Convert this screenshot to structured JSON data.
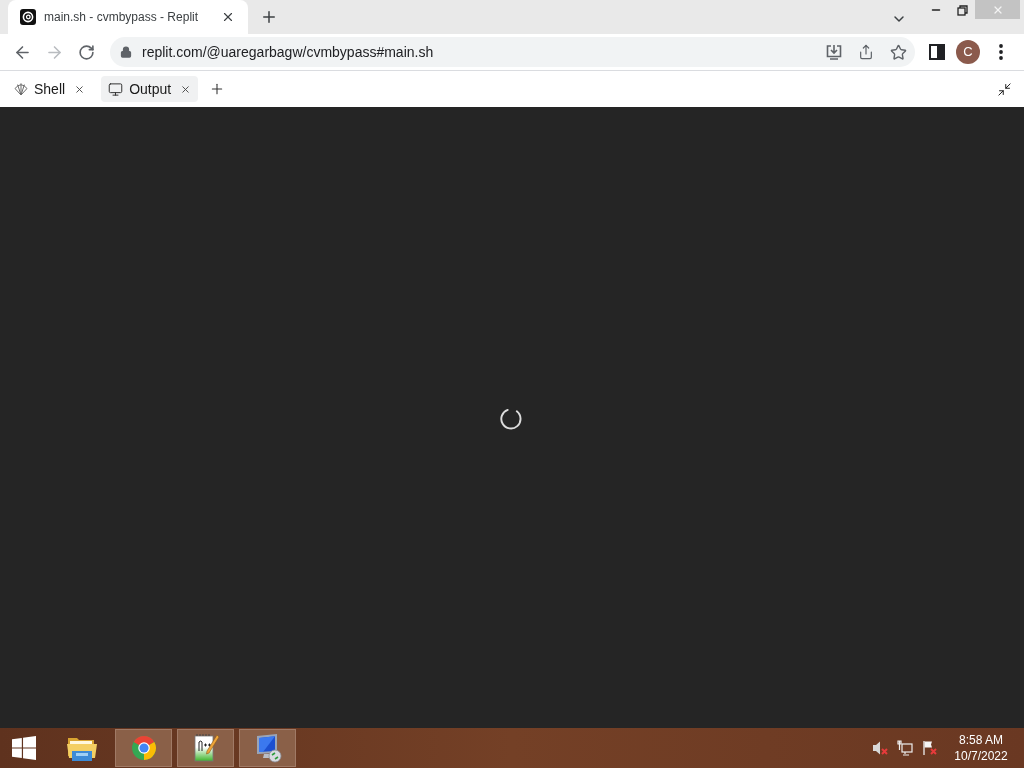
{
  "browser": {
    "tabs": [
      {
        "title": "main.sh - cvmbypass - Replit",
        "selected": true
      }
    ],
    "address": "replit.com/@uaregarbagw/cvmbypass#main.sh",
    "profile_initial": "C"
  },
  "workspace": {
    "tabs": [
      {
        "label": "Shell",
        "kind": "shell",
        "selected": false
      },
      {
        "label": "Output",
        "kind": "output",
        "selected": true
      }
    ]
  },
  "output": {
    "loading": true
  },
  "taskbar": {
    "apps": [
      {
        "kind": "explorer",
        "running": false
      },
      {
        "kind": "chrome",
        "running": true
      },
      {
        "kind": "notepad",
        "running": true
      },
      {
        "kind": "remote",
        "running": true
      }
    ],
    "time": "8:58 AM",
    "date": "10/7/2022"
  }
}
